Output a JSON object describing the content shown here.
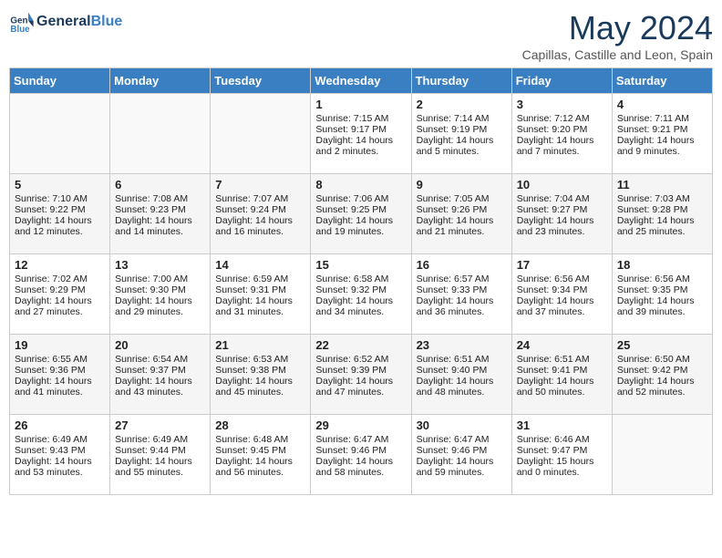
{
  "logo": {
    "text_general": "General",
    "text_blue": "Blue"
  },
  "header": {
    "month_title": "May 2024",
    "location": "Capillas, Castille and Leon, Spain"
  },
  "days_of_week": [
    "Sunday",
    "Monday",
    "Tuesday",
    "Wednesday",
    "Thursday",
    "Friday",
    "Saturday"
  ],
  "weeks": [
    [
      {
        "day": "",
        "info": ""
      },
      {
        "day": "",
        "info": ""
      },
      {
        "day": "",
        "info": ""
      },
      {
        "day": "1",
        "info": "Sunrise: 7:15 AM\nSunset: 9:17 PM\nDaylight: 14 hours and 2 minutes."
      },
      {
        "day": "2",
        "info": "Sunrise: 7:14 AM\nSunset: 9:19 PM\nDaylight: 14 hours and 5 minutes."
      },
      {
        "day": "3",
        "info": "Sunrise: 7:12 AM\nSunset: 9:20 PM\nDaylight: 14 hours and 7 minutes."
      },
      {
        "day": "4",
        "info": "Sunrise: 7:11 AM\nSunset: 9:21 PM\nDaylight: 14 hours and 9 minutes."
      }
    ],
    [
      {
        "day": "5",
        "info": "Sunrise: 7:10 AM\nSunset: 9:22 PM\nDaylight: 14 hours and 12 minutes."
      },
      {
        "day": "6",
        "info": "Sunrise: 7:08 AM\nSunset: 9:23 PM\nDaylight: 14 hours and 14 minutes."
      },
      {
        "day": "7",
        "info": "Sunrise: 7:07 AM\nSunset: 9:24 PM\nDaylight: 14 hours and 16 minutes."
      },
      {
        "day": "8",
        "info": "Sunrise: 7:06 AM\nSunset: 9:25 PM\nDaylight: 14 hours and 19 minutes."
      },
      {
        "day": "9",
        "info": "Sunrise: 7:05 AM\nSunset: 9:26 PM\nDaylight: 14 hours and 21 minutes."
      },
      {
        "day": "10",
        "info": "Sunrise: 7:04 AM\nSunset: 9:27 PM\nDaylight: 14 hours and 23 minutes."
      },
      {
        "day": "11",
        "info": "Sunrise: 7:03 AM\nSunset: 9:28 PM\nDaylight: 14 hours and 25 minutes."
      }
    ],
    [
      {
        "day": "12",
        "info": "Sunrise: 7:02 AM\nSunset: 9:29 PM\nDaylight: 14 hours and 27 minutes."
      },
      {
        "day": "13",
        "info": "Sunrise: 7:00 AM\nSunset: 9:30 PM\nDaylight: 14 hours and 29 minutes."
      },
      {
        "day": "14",
        "info": "Sunrise: 6:59 AM\nSunset: 9:31 PM\nDaylight: 14 hours and 31 minutes."
      },
      {
        "day": "15",
        "info": "Sunrise: 6:58 AM\nSunset: 9:32 PM\nDaylight: 14 hours and 34 minutes."
      },
      {
        "day": "16",
        "info": "Sunrise: 6:57 AM\nSunset: 9:33 PM\nDaylight: 14 hours and 36 minutes."
      },
      {
        "day": "17",
        "info": "Sunrise: 6:56 AM\nSunset: 9:34 PM\nDaylight: 14 hours and 37 minutes."
      },
      {
        "day": "18",
        "info": "Sunrise: 6:56 AM\nSunset: 9:35 PM\nDaylight: 14 hours and 39 minutes."
      }
    ],
    [
      {
        "day": "19",
        "info": "Sunrise: 6:55 AM\nSunset: 9:36 PM\nDaylight: 14 hours and 41 minutes."
      },
      {
        "day": "20",
        "info": "Sunrise: 6:54 AM\nSunset: 9:37 PM\nDaylight: 14 hours and 43 minutes."
      },
      {
        "day": "21",
        "info": "Sunrise: 6:53 AM\nSunset: 9:38 PM\nDaylight: 14 hours and 45 minutes."
      },
      {
        "day": "22",
        "info": "Sunrise: 6:52 AM\nSunset: 9:39 PM\nDaylight: 14 hours and 47 minutes."
      },
      {
        "day": "23",
        "info": "Sunrise: 6:51 AM\nSunset: 9:40 PM\nDaylight: 14 hours and 48 minutes."
      },
      {
        "day": "24",
        "info": "Sunrise: 6:51 AM\nSunset: 9:41 PM\nDaylight: 14 hours and 50 minutes."
      },
      {
        "day": "25",
        "info": "Sunrise: 6:50 AM\nSunset: 9:42 PM\nDaylight: 14 hours and 52 minutes."
      }
    ],
    [
      {
        "day": "26",
        "info": "Sunrise: 6:49 AM\nSunset: 9:43 PM\nDaylight: 14 hours and 53 minutes."
      },
      {
        "day": "27",
        "info": "Sunrise: 6:49 AM\nSunset: 9:44 PM\nDaylight: 14 hours and 55 minutes."
      },
      {
        "day": "28",
        "info": "Sunrise: 6:48 AM\nSunset: 9:45 PM\nDaylight: 14 hours and 56 minutes."
      },
      {
        "day": "29",
        "info": "Sunrise: 6:47 AM\nSunset: 9:46 PM\nDaylight: 14 hours and 58 minutes."
      },
      {
        "day": "30",
        "info": "Sunrise: 6:47 AM\nSunset: 9:46 PM\nDaylight: 14 hours and 59 minutes."
      },
      {
        "day": "31",
        "info": "Sunrise: 6:46 AM\nSunset: 9:47 PM\nDaylight: 15 hours and 0 minutes."
      },
      {
        "day": "",
        "info": ""
      }
    ]
  ]
}
